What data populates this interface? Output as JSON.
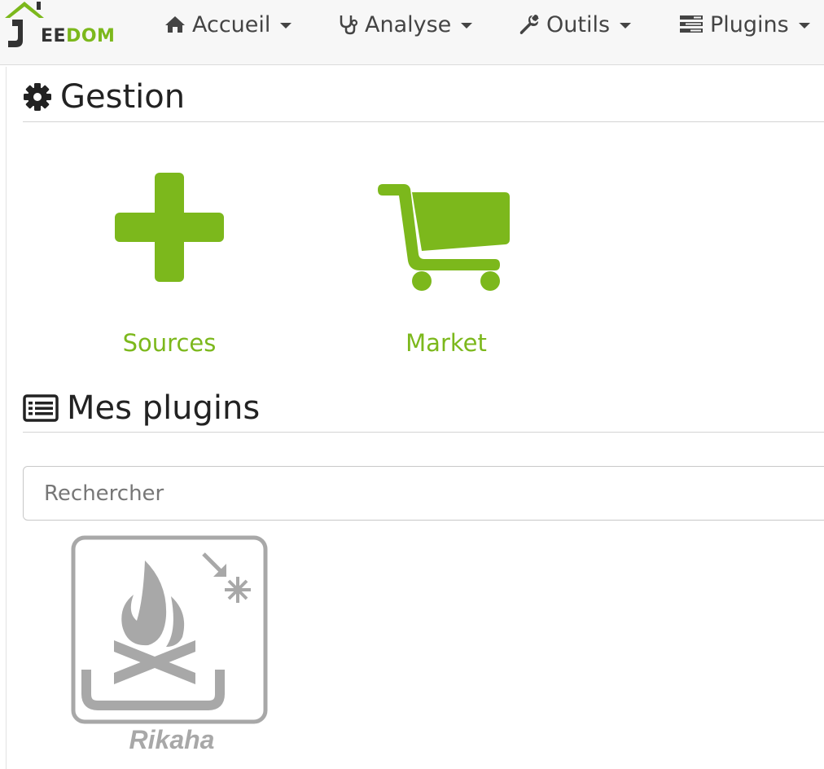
{
  "brand": {
    "logo_letter": "J",
    "logo_text_a": "EE",
    "logo_text_b": "DOM",
    "accent_color": "#7cb81c"
  },
  "nav": {
    "items": [
      {
        "label": "Accueil",
        "icon": "home-icon"
      },
      {
        "label": "Analyse",
        "icon": "stethoscope-icon"
      },
      {
        "label": "Outils",
        "icon": "wrench-icon"
      },
      {
        "label": "Plugins",
        "icon": "tasks-icon"
      }
    ]
  },
  "gestion": {
    "title": "Gestion",
    "icon": "gear-icon",
    "tiles": [
      {
        "label": "Sources",
        "icon": "plus-icon"
      },
      {
        "label": "Market",
        "icon": "cart-icon"
      }
    ]
  },
  "plugins": {
    "title": "Mes plugins",
    "icon": "list-icon",
    "search_placeholder": "Rechercher",
    "items": [
      {
        "name": "Rikaha",
        "icon": "stove-icon"
      }
    ]
  }
}
